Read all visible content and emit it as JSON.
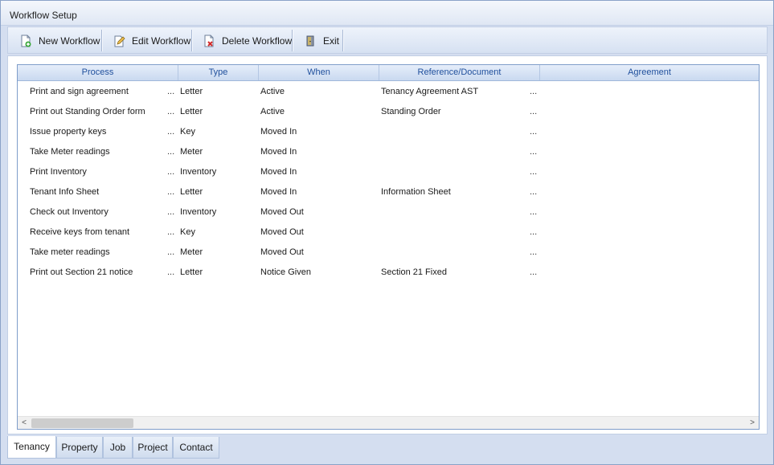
{
  "window": {
    "title": "Workflow Setup"
  },
  "toolbar": {
    "buttons": [
      {
        "label": "New Workflow",
        "icon": "new-document-icon"
      },
      {
        "label": "Edit Workflow",
        "icon": "edit-document-icon"
      },
      {
        "label": "Delete Workflow",
        "icon": "delete-document-icon"
      },
      {
        "label": "Exit",
        "icon": "exit-door-icon"
      }
    ]
  },
  "grid": {
    "columns": [
      "Process",
      "Type",
      "When",
      "Reference/Document",
      "Agreement"
    ],
    "ellipsis": "...",
    "rows": [
      {
        "process": "Print and sign agreement",
        "type": "Letter",
        "when": "Active",
        "reference": "Tenancy Agreement AST",
        "agreement": ""
      },
      {
        "process": "Print out Standing Order form",
        "type": "Letter",
        "when": "Active",
        "reference": "Standing Order",
        "agreement": ""
      },
      {
        "process": "Issue property keys",
        "type": "Key",
        "when": "Moved In",
        "reference": "",
        "agreement": ""
      },
      {
        "process": "Take Meter readings",
        "type": "Meter",
        "when": "Moved In",
        "reference": "",
        "agreement": ""
      },
      {
        "process": "Print Inventory",
        "type": "Inventory",
        "when": "Moved In",
        "reference": "",
        "agreement": ""
      },
      {
        "process": "Tenant Info Sheet",
        "type": "Letter",
        "when": "Moved In",
        "reference": "Information Sheet",
        "agreement": ""
      },
      {
        "process": "Check out Inventory",
        "type": "Inventory",
        "when": "Moved Out",
        "reference": "",
        "agreement": ""
      },
      {
        "process": "Receive keys from tenant",
        "type": "Key",
        "when": "Moved Out",
        "reference": "",
        "agreement": ""
      },
      {
        "process": "Take meter readings",
        "type": "Meter",
        "when": "Moved Out",
        "reference": "",
        "agreement": ""
      },
      {
        "process": "Print out Section 21 notice",
        "type": "Letter",
        "when": "Notice Given",
        "reference": "Section 21 Fixed",
        "agreement": ""
      }
    ]
  },
  "scrollbar": {
    "left_arrow": "<",
    "right_arrow": ">"
  },
  "tabs": [
    {
      "label": "Tenancy",
      "active": true
    },
    {
      "label": "Property",
      "active": false
    },
    {
      "label": "Job",
      "active": false
    },
    {
      "label": "Project",
      "active": false
    },
    {
      "label": "Contact",
      "active": false
    }
  ],
  "colors": {
    "header_text": "#1f4f9c",
    "accent": "#7f9dca"
  }
}
